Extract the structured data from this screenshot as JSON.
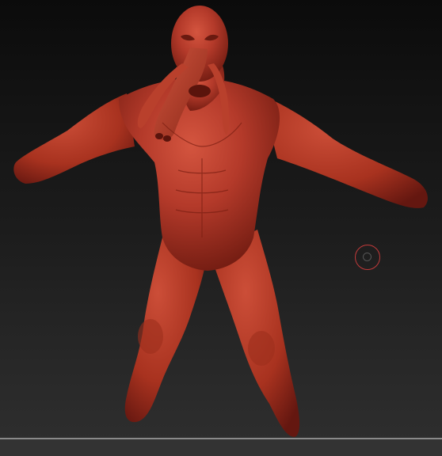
{
  "viewport": {
    "background_top": "#0b0b0b",
    "background_bottom": "#2f2f2f"
  },
  "model": {
    "material_color": "#b43a2a",
    "highlight_color": "#e0705a",
    "shadow_color": "#5a140c"
  },
  "cursor": {
    "ring_color": "#c23a3a"
  }
}
